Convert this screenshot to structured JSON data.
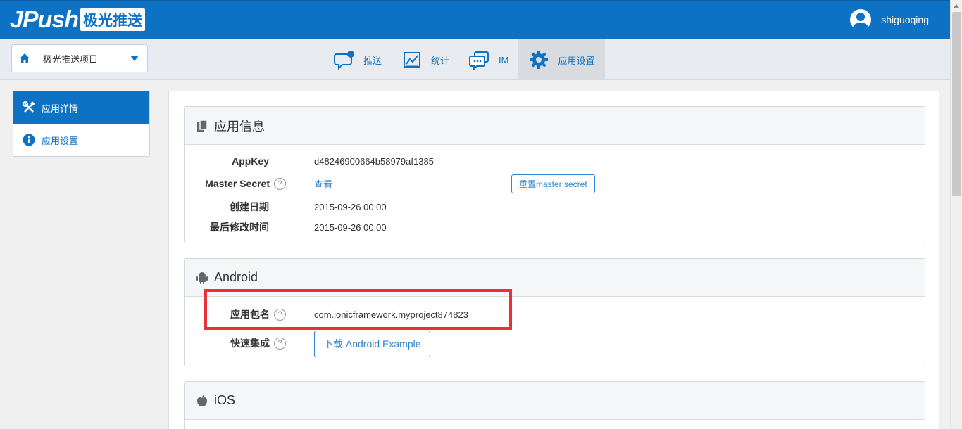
{
  "header": {
    "logo_text": "JPush",
    "logo_cn": "极光推送",
    "username": "shiguoqing"
  },
  "subnav": {
    "project_name": "极光推送项目",
    "tabs": [
      {
        "label": "推送",
        "icon": "chat-bubble-icon"
      },
      {
        "label": "统计",
        "icon": "chart-icon"
      },
      {
        "label": "IM",
        "icon": "im-icon"
      },
      {
        "label": "应用设置",
        "icon": "gear-icon",
        "active": true
      }
    ]
  },
  "sidebar": {
    "items": [
      {
        "label": "应用详情",
        "icon": "tools-icon",
        "active": true
      },
      {
        "label": "应用设置",
        "icon": "info-icon"
      }
    ]
  },
  "app_info": {
    "title": "应用信息",
    "appkey_label": "AppKey",
    "appkey_value": "d48246900664b58979af1385",
    "master_secret_label": "Master Secret",
    "master_secret_link": "查看",
    "reset_button": "重置master secret",
    "created_label": "创建日期",
    "created_value": "2015-09-26 00:00",
    "modified_label": "最后修改时间",
    "modified_value": "2015-09-26 00:00"
  },
  "android": {
    "title": "Android",
    "package_label": "应用包名",
    "package_value": "com.ionicframework.myproject874823",
    "quick_label": "快速集成",
    "download_button": "下载 Android Example"
  },
  "ios": {
    "title": "iOS"
  },
  "help_glyph": "?",
  "colors": {
    "brand_blue": "#0e72c4",
    "highlight_red": "#e8323a"
  }
}
